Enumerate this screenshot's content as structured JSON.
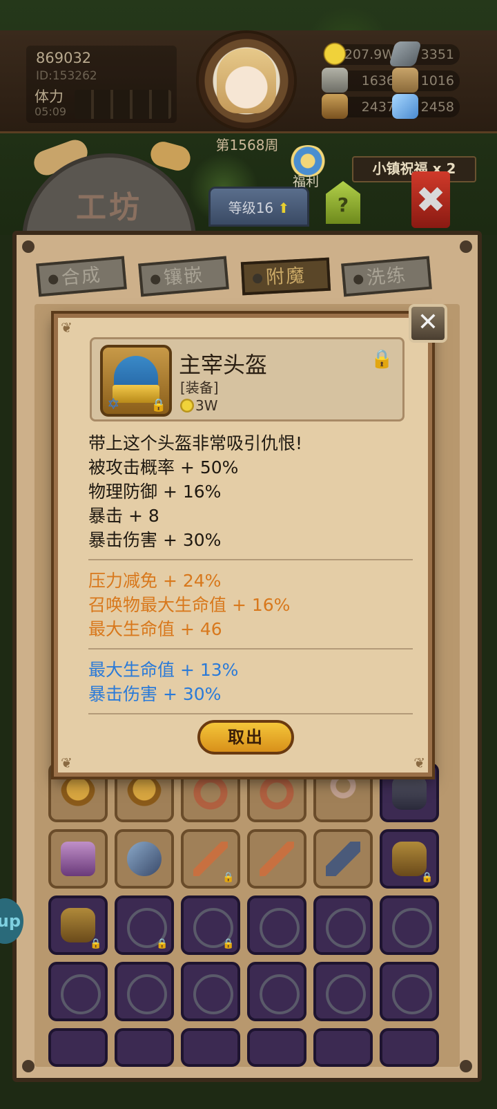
{
  "player": {
    "score": "869032",
    "id": "ID:153262",
    "stamina_label": "体力",
    "stamina_timer": "05:09",
    "week": "第1568周"
  },
  "resources": [
    {
      "name": "gold",
      "value": "207.9W"
    },
    {
      "name": "iron",
      "value": "3351"
    },
    {
      "name": "stone",
      "value": "1636"
    },
    {
      "name": "paper",
      "value": "1016"
    },
    {
      "name": "wood",
      "value": "2437"
    },
    {
      "name": "crystal",
      "value": "2458"
    }
  ],
  "header": {
    "title": "工坊",
    "level": "等级16",
    "help": "?",
    "welfare": "福利",
    "blessing": "小镇祝福 x 2"
  },
  "tabs": [
    {
      "label": "合成",
      "active": false
    },
    {
      "label": "镶嵌",
      "active": false
    },
    {
      "label": "附魔",
      "active": true
    },
    {
      "label": "洗练",
      "active": false
    }
  ],
  "item": {
    "name": "主宰头盔",
    "type": "[装备]",
    "price": "3W",
    "description": "带上这个头盔非常吸引仇恨!",
    "base_stats": [
      "被攻击概率 + 50%",
      "物理防御 + 16%",
      "暴击 + 8",
      "暴击伤害 + 30%"
    ],
    "bonus_stats": [
      "压力减免 + 24%",
      "召唤物最大生命值 + 16%",
      "最大生命值 + 46"
    ],
    "enchant_stats": [
      "最大生命值 + 13%",
      "暴击伤害 + 30%"
    ],
    "take_out_label": "取出"
  },
  "side_bubble": "up",
  "colors": {
    "orange_stat": "#d8781c",
    "blue_stat": "#2a7ad8",
    "panel": "#cdb08a"
  }
}
